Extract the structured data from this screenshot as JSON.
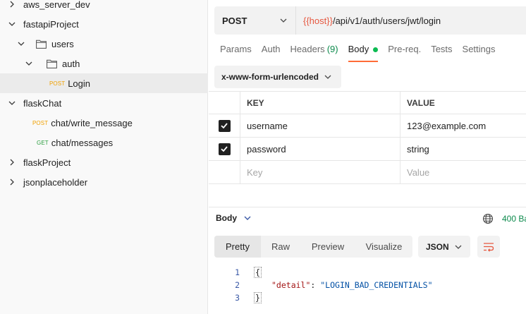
{
  "sidebar": {
    "items": [
      {
        "label": "aws_server_dev",
        "type": "collection",
        "expanded": false
      },
      {
        "label": "fastapiProject",
        "type": "collection",
        "expanded": true
      },
      {
        "label": "users",
        "type": "folder",
        "expanded": true
      },
      {
        "label": "auth",
        "type": "folder",
        "expanded": true
      },
      {
        "label": "Login",
        "type": "request",
        "method": "POST",
        "selected": true
      },
      {
        "label": "flaskChat",
        "type": "collection",
        "expanded": true
      },
      {
        "label": "chat/write_message",
        "type": "request",
        "method": "POST"
      },
      {
        "label": "chat/messages",
        "type": "request",
        "method": "GET"
      },
      {
        "label": "flaskProject",
        "type": "collection",
        "expanded": false
      },
      {
        "label": "jsonplaceholder",
        "type": "collection",
        "expanded": false
      }
    ]
  },
  "request": {
    "method": "POST",
    "url_var": "{{host}}",
    "url_path": "/api/v1/auth/users/jwt/login"
  },
  "tabs": {
    "params": "Params",
    "auth": "Auth",
    "headers": "Headers",
    "headers_count": "(9)",
    "body": "Body",
    "prereq": "Pre-req.",
    "tests": "Tests",
    "settings": "Settings"
  },
  "body_type": "x-www-form-urlencoded",
  "kv": {
    "key_header": "KEY",
    "value_header": "VALUE",
    "rows": [
      {
        "key": "username",
        "value": "123@example.com",
        "checked": true
      },
      {
        "key": "password",
        "value": "string",
        "checked": true
      }
    ],
    "key_placeholder": "Key",
    "value_placeholder": "Value"
  },
  "response": {
    "label": "Body",
    "status": "400 Ba",
    "view_tabs": [
      "Pretty",
      "Raw",
      "Preview",
      "Visualize"
    ],
    "format": "JSON",
    "code": {
      "line1": "1",
      "line2": "2",
      "line3": "3",
      "open_brace": "{",
      "close_brace": "}",
      "key": "\"detail\"",
      "colon": ": ",
      "value": "\"LOGIN_BAD_CREDENTIALS\""
    }
  },
  "colors": {
    "accent": "#ff6c37",
    "post": "#f0a000",
    "get": "#2c9e3f",
    "url_var": "#e6573f",
    "status": "#0c8a4c"
  }
}
